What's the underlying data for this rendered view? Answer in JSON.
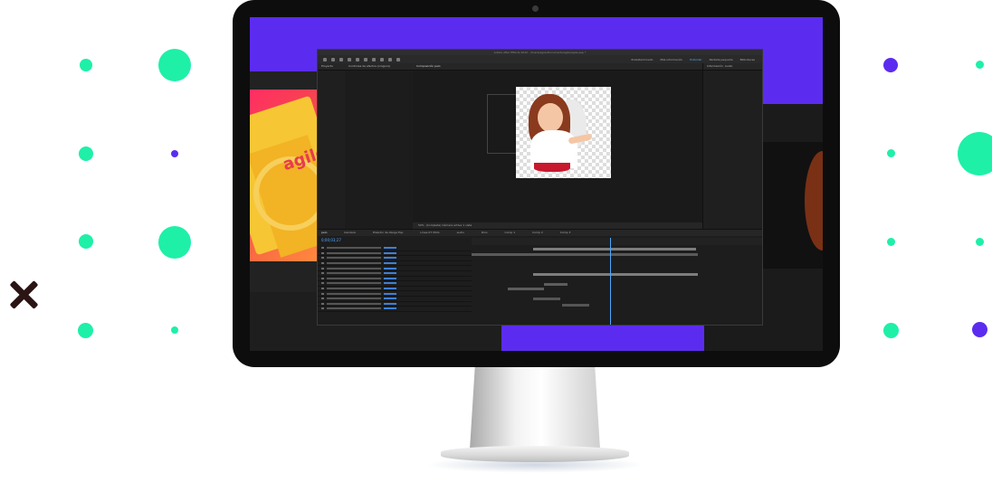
{
  "app": {
    "title": "Adobe After Effects 2020 - /Users/agile/Documents/agile/agile.aep *",
    "workspaces": [
      "Predeterminado",
      "Más información",
      "Estándar",
      "Pantalla pequeña",
      "Bibliotecas"
    ],
    "active_workspace": "Estándar",
    "search_placeholder": "Buscar en la Ayuda"
  },
  "panels": {
    "project_tab": "Proyecto",
    "effects_tab": "Controles de efectos (ninguno)",
    "composition_tab": "Composición pelo",
    "composition_subtabs": [
      "Comp 1",
      "pelo"
    ],
    "viewer_bar": "(Completa)   Cámara activa   1 vista",
    "zoom": "50%",
    "info_tab": "Información",
    "audio_tab": "Audio",
    "preview_tab": "Previsualización",
    "libraries_tab": "Bibliotecas",
    "libraries_title": "Organizar las bibliotecas a su manera",
    "libraries_body": "Utilice grupos personalizados para organizar las bibliotecas y acceder a ellas de manera rápida y sencilla.",
    "libraries_button": "Crear grupo",
    "align_tab": "Alinear"
  },
  "timeline": {
    "tabs": [
      "pelo",
      "bandera",
      "Preludio de Aboga Esp",
      "Línea 07 Moto",
      "audio",
      "Rino",
      "Comp 1",
      "Comp 2",
      "Comp 3"
    ],
    "active_tab": "pelo",
    "timecode": "0;00;03;27",
    "layers": [
      {
        "name": "Fondo",
        "parent": "Ninguno"
      },
      {
        "name": "Aumento de tiempo",
        "parent": ""
      },
      {
        "name": "Transformar",
        "parent": "Restablecer"
      },
      {
        "name": "Audio",
        "parent": ""
      },
      {
        "name": "Niveles de audio",
        "parent": "+0,00 dB"
      },
      {
        "name": "Forma de onda",
        "parent": ""
      },
      {
        "name": "Ilustración 36",
        "parent": "6. Ilustración"
      },
      {
        "name": "Ilustración 35",
        "parent": "7. Ilustración"
      },
      {
        "name": "Rotación",
        "parent": "0x+0,0°"
      },
      {
        "name": "Ilustración 34",
        "parent": "8. Ilustración"
      },
      {
        "name": "Ilustración 33",
        "parent": "9. Ilustración"
      },
      {
        "name": "Rotación",
        "parent": "0x+10,0°"
      },
      {
        "name": "Ilustración 32",
        "parent": "Ninguno"
      }
    ]
  },
  "poster": {
    "brand": "agile"
  },
  "colors": {
    "accent_green": "#1ef0a8",
    "accent_purple": "#5b2cf0",
    "x_mark": "#2b1414",
    "ae_blue": "#4ea8ff",
    "ae_bg": "#232323"
  }
}
